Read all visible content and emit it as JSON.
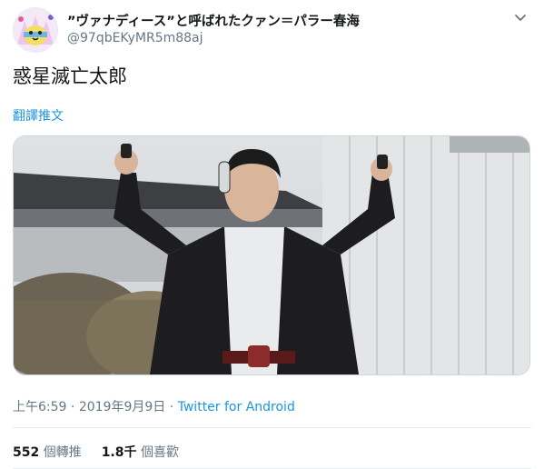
{
  "tweet": {
    "display_name": "”ヴァナディース”と呼ばれたクァン＝パラー春海",
    "handle": "@97qbEKyMR5m88aj",
    "text": "惑星滅亡太郎",
    "translate_label": "翻譯推文",
    "time": "上午6:59",
    "separator": " · ",
    "date": "2019年9月9日",
    "source": "Twitter for Android",
    "retweet_count": "552",
    "retweet_label": "個轉推",
    "like_count": "1.8千",
    "like_label": "個喜歡"
  },
  "colors": {
    "link": "#1b95e0",
    "secondary_text": "#657786",
    "primary_text": "#14171a",
    "divider": "#e6ecf0"
  },
  "icons": {
    "caret": "chevron-down-icon",
    "avatar": "avatar-illustration"
  }
}
